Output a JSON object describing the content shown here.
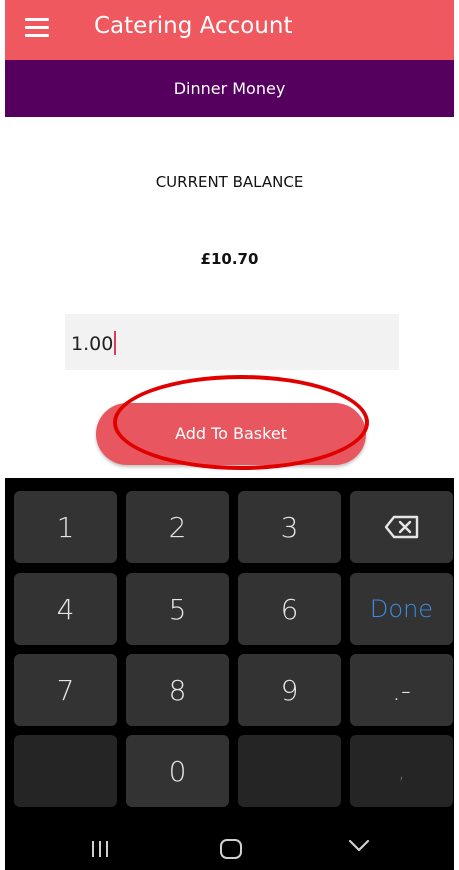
{
  "app": {
    "title": "Catering Account",
    "menu_icon": "hamburger-menu-icon"
  },
  "subheader": {
    "title": "Dinner Money"
  },
  "balance": {
    "label": "CURRENT BALANCE",
    "value": "£10.70"
  },
  "amount_input": {
    "value": "1.00"
  },
  "add_button": {
    "label": "Add To Basket"
  },
  "colors": {
    "app_bar": "#f0585f",
    "sub_bar": "#55005e",
    "button": "#e8575f",
    "annotation": "#e00000",
    "done_key": "#3a8ee6"
  },
  "keypad": {
    "keys": [
      "1",
      "2",
      "3",
      "backspace-icon",
      "4",
      "5",
      "6",
      "Done",
      "7",
      "8",
      "9",
      ".-",
      "",
      "0",
      "",
      ","
    ]
  },
  "navbar": {
    "icons": [
      "recent-apps-icon",
      "home-icon",
      "back-icon"
    ]
  }
}
